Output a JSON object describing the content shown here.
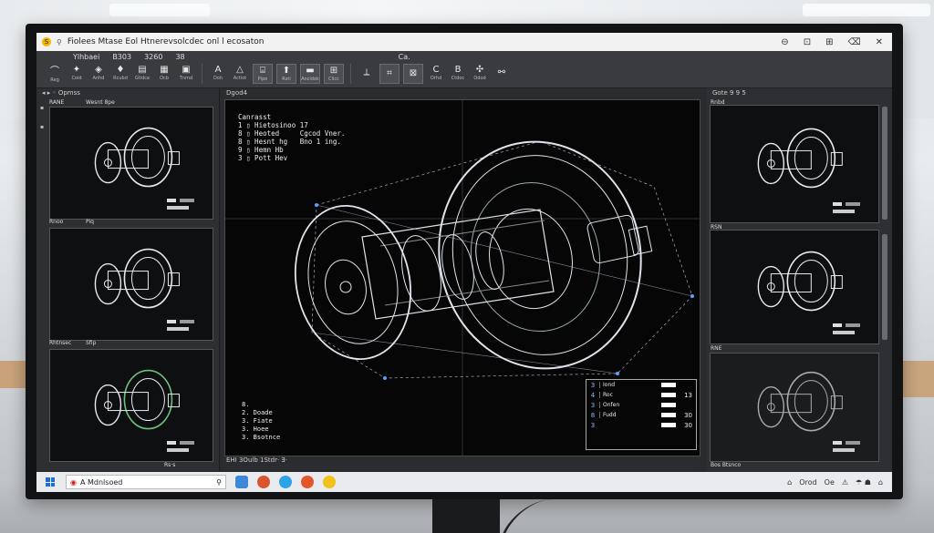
{
  "window": {
    "title": "Fiolees Mtase Eol Htnerevsolcdec onl l ecosaton",
    "app_badge": "S",
    "controls": [
      "⊖",
      "⊡",
      "⊞",
      "⌫",
      "✕"
    ]
  },
  "ribbon": {
    "tabs": [
      "Ylhbaei",
      "B303",
      "3260",
      "38",
      "Ca."
    ],
    "tools": [
      {
        "icon": "angle-icon",
        "glyph": "⌒",
        "label": "Reg"
      },
      {
        "icon": "pointer-icon",
        "glyph": "✦",
        "label": "Coid"
      },
      {
        "icon": "fill-icon",
        "glyph": "◈",
        "label": "Anhd"
      },
      {
        "icon": "ink-drop-icon",
        "glyph": "♦",
        "label": "Rcubd"
      },
      {
        "icon": "table-icon",
        "glyph": "▤",
        "label": "Gtidce"
      },
      {
        "icon": "grid-icon",
        "glyph": "▦",
        "label": "Ocb"
      },
      {
        "icon": "frame-icon",
        "glyph": "▣",
        "label": "Tnmd"
      },
      {
        "icon": "text-icon",
        "glyph": "A",
        "label": "Doh"
      },
      {
        "icon": "triangle-icon",
        "glyph": "△",
        "label": "Actiot"
      },
      {
        "icon": "ruler-icon",
        "glyph": "⌸",
        "label": "Plpe"
      },
      {
        "icon": "arrow-up-icon",
        "glyph": "⬆",
        "label": "Rsti"
      },
      {
        "icon": "print-icon",
        "glyph": "▬",
        "label": "Ancidok"
      },
      {
        "icon": "layers-icon",
        "glyph": "⊞",
        "label": "Clicc"
      },
      {
        "icon": "measure-icon",
        "glyph": "⟂",
        "label": ""
      },
      {
        "icon": "snap-icon",
        "glyph": "⌗",
        "label": ""
      },
      {
        "icon": "crop-icon",
        "glyph": "⊠",
        "label": ""
      },
      {
        "icon": "curve-icon",
        "glyph": "C",
        "label": "Orhd"
      },
      {
        "icon": "brace-icon",
        "glyph": "B",
        "label": "Ctdoc"
      },
      {
        "icon": "fx-icon",
        "glyph": "✣",
        "label": "Odod"
      },
      {
        "icon": "link-icon",
        "glyph": "⚯",
        "label": ""
      }
    ]
  },
  "left_panel": {
    "header": "Opmss",
    "thumbs": [
      {
        "label": "RANE",
        "caption": "Wesnt 8pe"
      },
      {
        "label": "Rnoo",
        "caption": "Piq"
      },
      {
        "label": "Rhtnsec",
        "caption": "Sfip"
      }
    ],
    "footer": "Rs·s"
  },
  "viewport": {
    "tab": "Dgod4",
    "status": "EHI 3Oulb  1Stdr· Ǝ·",
    "legend_header": "Canrasst",
    "legend": [
      "1 ▯ Hietosinoo 17",
      "8 ▯ Heoted     Cgcod Vner.",
      "8 ▯ Hesnt hg   Bno 1 ing.",
      "9 ▯ Hemn Hb",
      "3 ▯ Pott Hev"
    ],
    "parts": [
      {
        "n": "8.",
        "t": ""
      },
      {
        "n": "2.",
        "t": "Doade"
      },
      {
        "n": "3.",
        "t": "Fiate"
      },
      {
        "n": "3.",
        "t": "Hoee"
      },
      {
        "n": "3.",
        "t": "Bsotnce"
      }
    ],
    "bom": [
      {
        "n": "3",
        "c": "Iond",
        "v": ""
      },
      {
        "n": "4",
        "c": "Roc",
        "v": "13"
      },
      {
        "n": "3",
        "c": "Onfen",
        "v": ""
      },
      {
        "n": "8",
        "c": "Fudd",
        "v": "30"
      },
      {
        "n": "3",
        "c": "",
        "v": "30"
      }
    ]
  },
  "right_panel": {
    "header": "Gote 9 9 5",
    "thumbs": [
      {
        "label": "Rnbd"
      },
      {
        "label": "RSN"
      },
      {
        "label": "RNE"
      }
    ],
    "footer": "Bos Btsnco"
  },
  "taskbar": {
    "search_text": "A Mdnlsoed",
    "tray": [
      "⌂",
      "Orod",
      "Oe",
      "⚠",
      "☂ ☗",
      "⌂"
    ]
  }
}
